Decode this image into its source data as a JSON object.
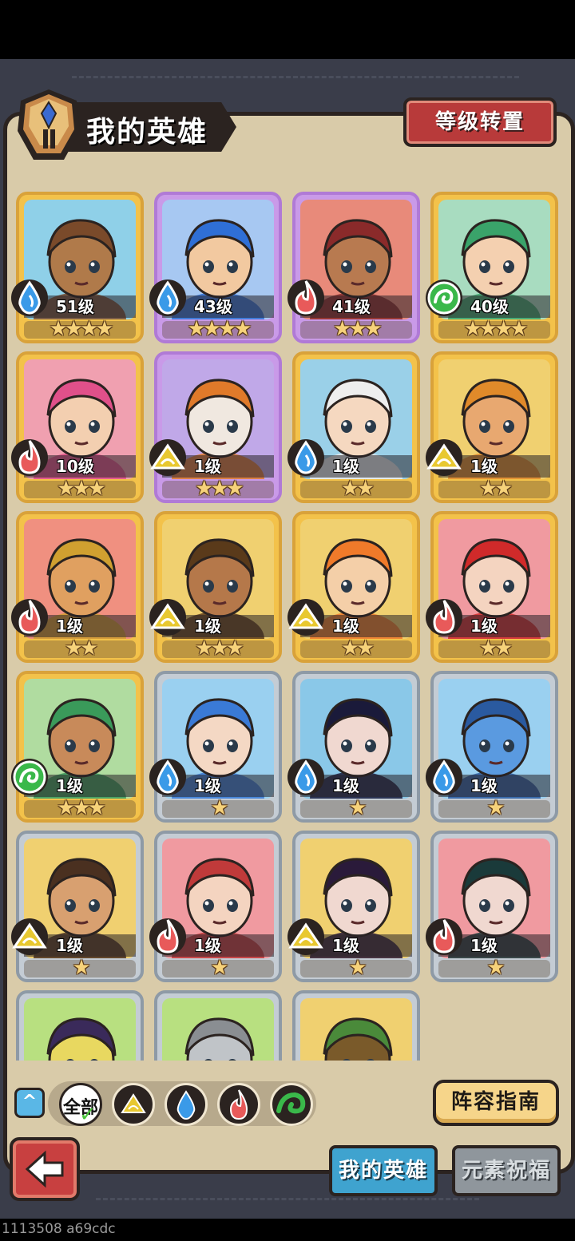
{
  "header": {
    "title": "我的英雄",
    "transfer_label": "等级转置"
  },
  "heroes": [
    {
      "level": "51级",
      "stars": "★★★★",
      "element": "water",
      "frame": "gold",
      "skin": "#b07a4a",
      "hair": "#7a4a2a",
      "bg": "#8fd0e8"
    },
    {
      "level": "43级",
      "stars": "★★★★",
      "element": "water",
      "frame": "purple",
      "skin": "#f2c9a0",
      "hair": "#2f6fd6",
      "bg": "#a7c8f2"
    },
    {
      "level": "41级",
      "stars": "★★★",
      "element": "fire",
      "frame": "purple",
      "skin": "#b87a50",
      "hair": "#8a2a2a",
      "bg": "#e88a7a"
    },
    {
      "level": "40级",
      "stars": "★★★★",
      "element": "wind",
      "frame": "gold",
      "skin": "#f4d0b0",
      "hair": "#3aa36a",
      "bg": "#a8dcc0"
    },
    {
      "level": "10级",
      "stars": "★★★",
      "element": "fire",
      "frame": "gold",
      "skin": "#f3cfb0",
      "hair": "#e0508a",
      "bg": "#f0a0b0"
    },
    {
      "level": "1级",
      "stars": "★★★",
      "element": "earth",
      "frame": "purple",
      "skin": "#f0e8e0",
      "hair": "#e07a2a",
      "bg": "#c0a8e8"
    },
    {
      "level": "1级",
      "stars": "★★",
      "element": "water",
      "frame": "gold",
      "skin": "#f5d8c0",
      "hair": "#eeeeee",
      "bg": "#9ad0e8"
    },
    {
      "level": "1级",
      "stars": "★★",
      "element": "earth",
      "frame": "gold",
      "skin": "#e8a870",
      "hair": "#e08a2a",
      "bg": "#f0d070"
    },
    {
      "level": "1级",
      "stars": "★★",
      "element": "fire",
      "frame": "gold",
      "skin": "#e0a060",
      "hair": "#d0a030",
      "bg": "#f09080"
    },
    {
      "level": "1级",
      "stars": "★★★",
      "element": "earth",
      "frame": "gold",
      "skin": "#b5784a",
      "hair": "#5a3a1a",
      "bg": "#f0d070"
    },
    {
      "level": "1级",
      "stars": "★★",
      "element": "earth",
      "frame": "gold",
      "skin": "#f4cfa8",
      "hair": "#f07a2a",
      "bg": "#f0d070"
    },
    {
      "level": "1级",
      "stars": "★★",
      "element": "fire",
      "frame": "gold",
      "skin": "#f4d4c0",
      "hair": "#d02a2a",
      "bg": "#f09aa0"
    },
    {
      "level": "1级",
      "stars": "★★★",
      "element": "wind",
      "frame": "gold",
      "skin": "#c88a5a",
      "hair": "#3a9a5a",
      "bg": "#b0dca0"
    },
    {
      "level": "1级",
      "stars": "★",
      "element": "water",
      "frame": "silver",
      "skin": "#f4d8c4",
      "hair": "#3a7ad6",
      "bg": "#9ad0f0"
    },
    {
      "level": "1级",
      "stars": "★",
      "element": "water",
      "frame": "silver",
      "skin": "#f0d8d0",
      "hair": "#1a1a3a",
      "bg": "#8ac8e8"
    },
    {
      "level": "1级",
      "stars": "★",
      "element": "water",
      "frame": "silver",
      "skin": "#5a9ae0",
      "hair": "#2a5aa0",
      "bg": "#9ad0f0"
    },
    {
      "level": "1级",
      "stars": "★",
      "element": "earth",
      "frame": "silver",
      "skin": "#d8a070",
      "hair": "#4a3020",
      "bg": "#f0d070"
    },
    {
      "level": "1级",
      "stars": "★",
      "element": "fire",
      "frame": "silver",
      "skin": "#f4d4c0",
      "hair": "#c03a3a",
      "bg": "#f09aa0"
    },
    {
      "level": "1级",
      "stars": "★",
      "element": "earth",
      "frame": "silver",
      "skin": "#f0d8d0",
      "hair": "#2a1a3a",
      "bg": "#f0d070"
    },
    {
      "level": "1级",
      "stars": "★",
      "element": "fire",
      "frame": "silver",
      "skin": "#f0d8d0",
      "hair": "#1a3a3a",
      "bg": "#f09aa0"
    },
    {
      "level": "",
      "stars": "",
      "element": "",
      "frame": "silver",
      "skin": "#e8d860",
      "hair": "#3a2a5a",
      "bg": "#b8e080"
    },
    {
      "level": "",
      "stars": "",
      "element": "",
      "frame": "silver",
      "skin": "#c0c4c8",
      "hair": "#8a8e92",
      "bg": "#b8e080"
    },
    {
      "level": "",
      "stars": "",
      "element": "",
      "frame": "silver",
      "skin": "#7a5a2a",
      "hair": "#4a8a3a",
      "bg": "#f0d070"
    }
  ],
  "filters": {
    "all_label": "全部",
    "items": [
      "earth",
      "water",
      "fire",
      "wind"
    ]
  },
  "buttons": {
    "guide_label": "阵容指南"
  },
  "tabs": {
    "my_heroes": "我的英雄",
    "element_blessing": "元素祝福"
  },
  "debug_text": "1113508 a69cdc",
  "colors": {
    "water": "#3a9ae8",
    "fire": "#e85a5a",
    "wind": "#3ab84a",
    "earth": "#e8c830",
    "panel": "#d9cba9",
    "frame_gold": "#f3c24a",
    "frame_purple": "#c99ae8",
    "frame_silver": "#c4ccd4"
  }
}
